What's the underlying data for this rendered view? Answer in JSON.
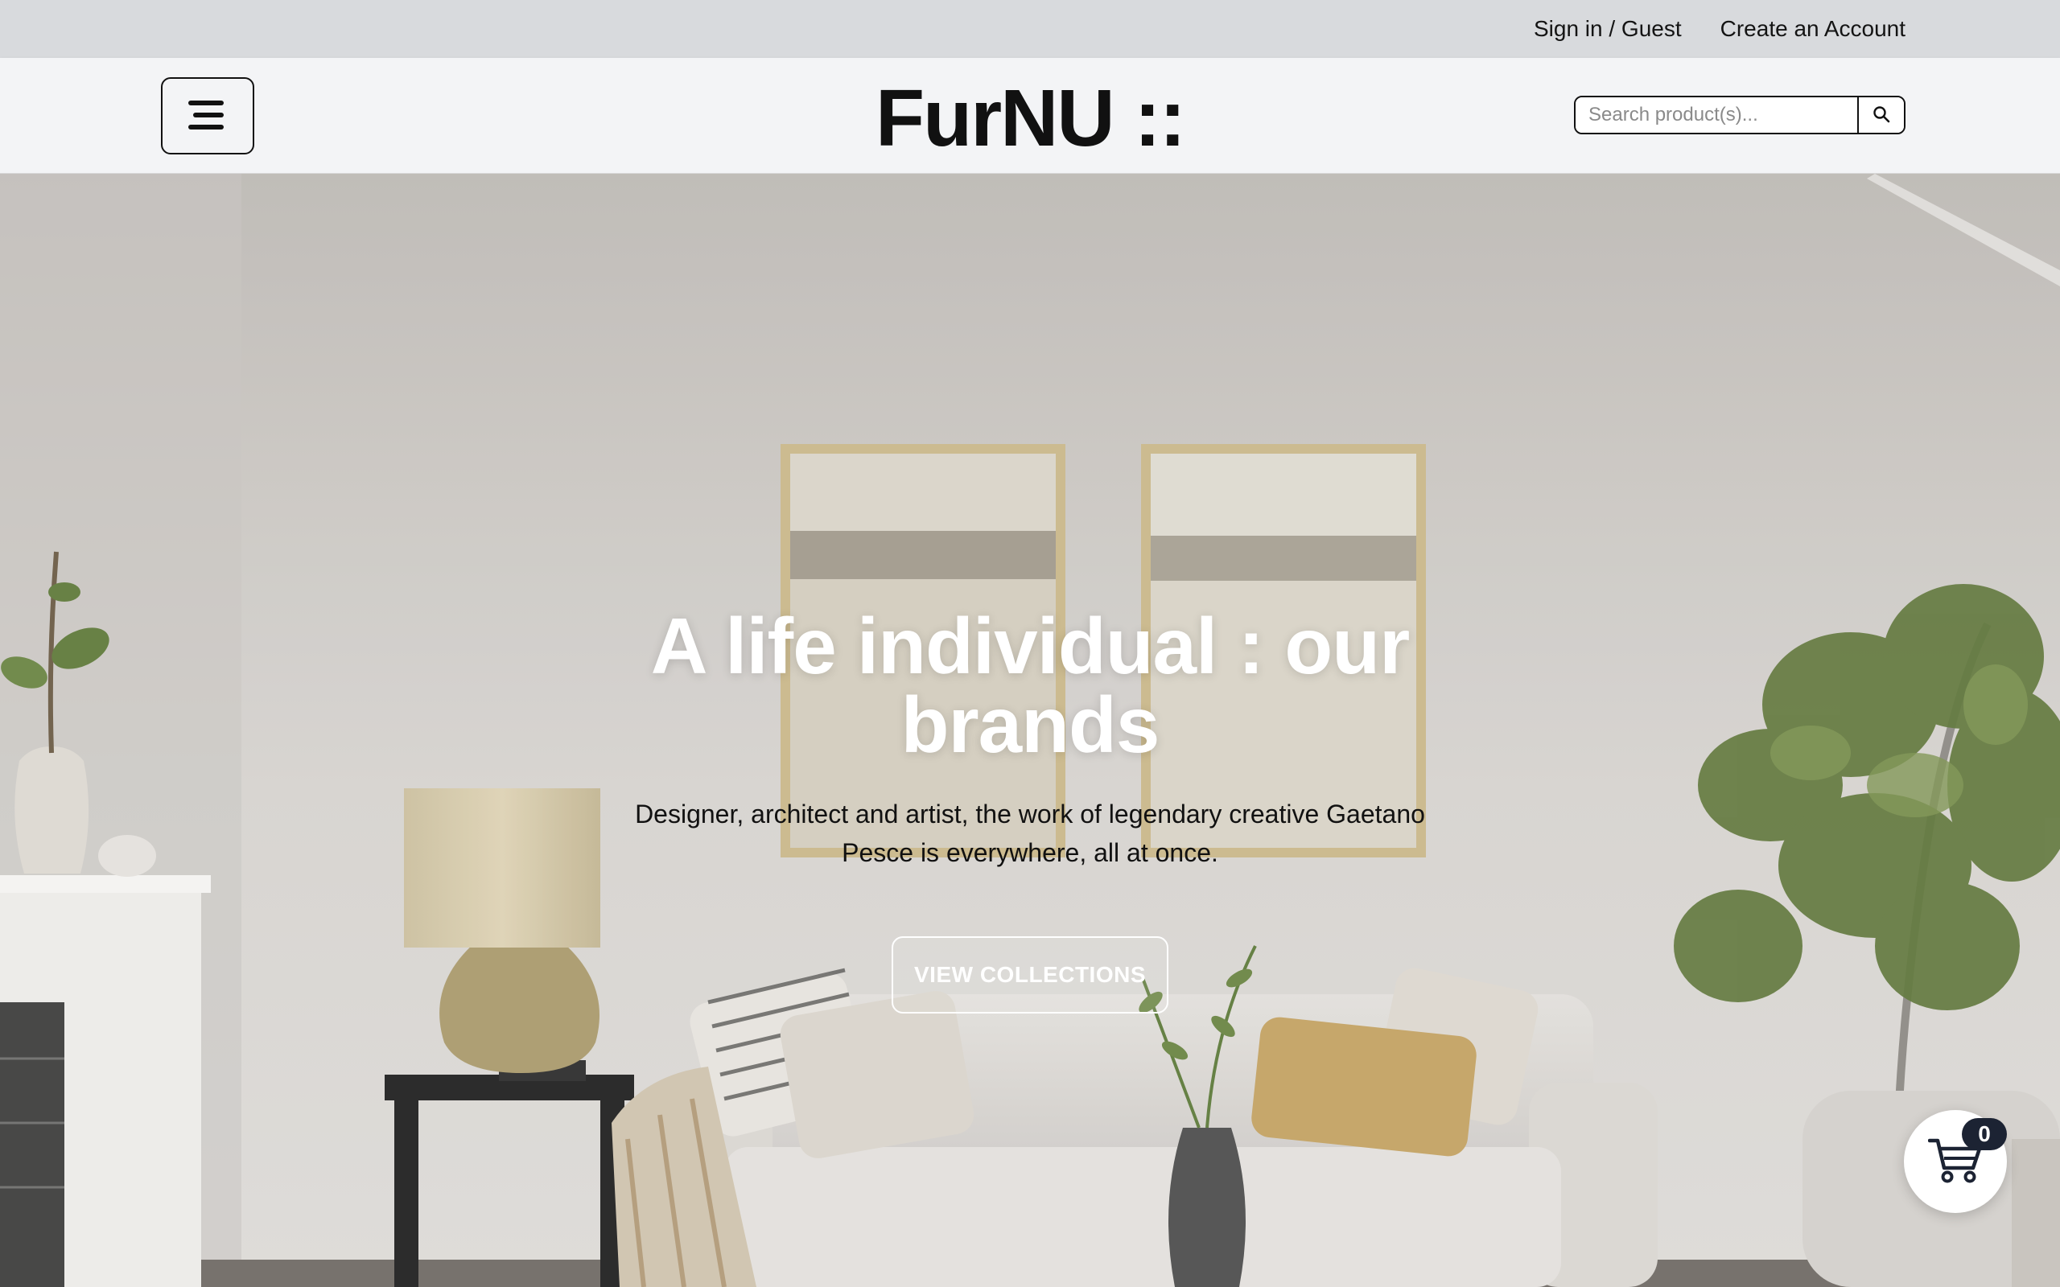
{
  "topbar": {
    "sign_in": "Sign in / Guest",
    "create_account": "Create an Account"
  },
  "header": {
    "brand": "FurNU ::",
    "menu_icon": "hamburger-menu-icon",
    "search": {
      "placeholder": "Search product(s)...",
      "value": "",
      "button_icon": "search-icon"
    }
  },
  "hero": {
    "title": "A life individual : our brands",
    "description": "Designer, architect and artist, the work of legendary creative Gaetano Pesce is everywhere, all at once.",
    "cta": "VIEW COLLECTIONS",
    "background": "living-room-photo"
  },
  "cart": {
    "icon": "shopping-cart-icon",
    "count": "0"
  },
  "colors": {
    "topbar_bg": "#d8dadd",
    "header_bg": "#f3f4f6",
    "text_dark": "#111111",
    "badge_bg": "#1c2333"
  }
}
